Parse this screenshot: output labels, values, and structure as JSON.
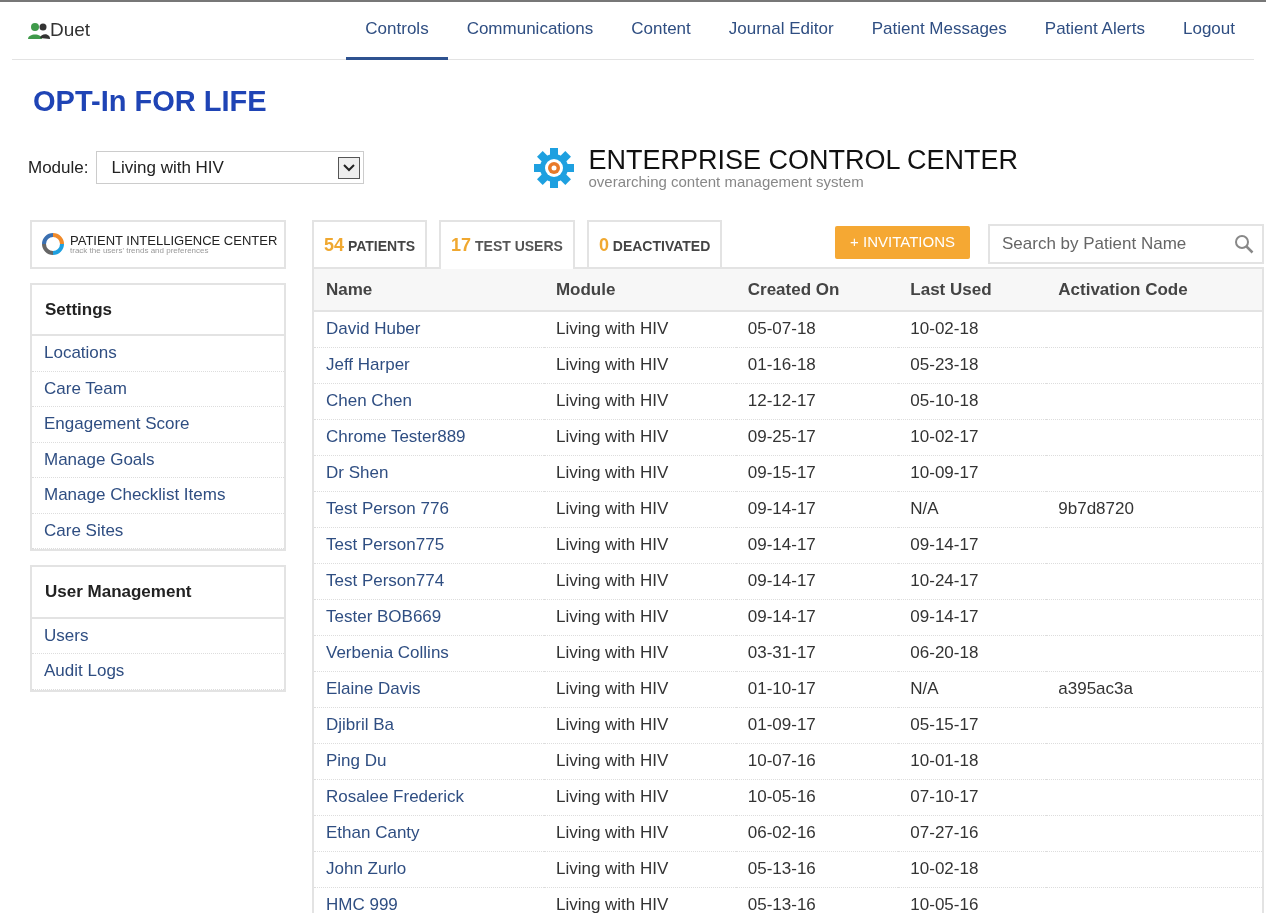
{
  "brand": "Duet",
  "nav": [
    {
      "label": "Controls",
      "selected": true
    },
    {
      "label": "Communications",
      "selected": false
    },
    {
      "label": "Content",
      "selected": false
    },
    {
      "label": "Journal Editor",
      "selected": false
    },
    {
      "label": "Patient Messages",
      "selected": false
    },
    {
      "label": "Patient Alerts",
      "selected": false
    },
    {
      "label": "Logout",
      "selected": false
    }
  ],
  "page_title": "OPT-In FOR LIFE",
  "module_label": "Module:",
  "module_value": "Living with HIV",
  "ecc": {
    "title": "ENTERPRISE CONTROL CENTER",
    "subtitle": "overarching content management system"
  },
  "pic": {
    "title": "PATIENT INTELLIGENCE CENTER",
    "subtitle": "track the users' trends and preferences"
  },
  "sidebar": [
    {
      "heading": "Settings",
      "items": [
        "Locations",
        "Care Team",
        "Engagement Score",
        "Manage Goals",
        "Manage Checklist Items",
        "Care Sites"
      ]
    },
    {
      "heading": "User Management",
      "items": [
        "Users",
        "Audit Logs"
      ]
    }
  ],
  "tabs": [
    {
      "count": "54",
      "label": "PATIENTS",
      "selected": false
    },
    {
      "count": "17",
      "label": "TEST USERS",
      "selected": true
    },
    {
      "count": "0",
      "label": "DEACTIVATED",
      "selected": false
    }
  ],
  "invite_button": "+ INVITATIONS",
  "search": {
    "placeholder": "Search by Patient Name"
  },
  "table": {
    "columns": [
      "Name",
      "Module",
      "Created On",
      "Last Used",
      "Activation Code"
    ],
    "rows": [
      [
        "David Huber",
        "Living with HIV",
        "05-07-18",
        "10-02-18",
        ""
      ],
      [
        "Jeff Harper",
        "Living with HIV",
        "01-16-18",
        "05-23-18",
        ""
      ],
      [
        "Chen Chen",
        "Living with HIV",
        "12-12-17",
        "05-10-18",
        ""
      ],
      [
        "Chrome Tester889",
        "Living with HIV",
        "09-25-17",
        "10-02-17",
        ""
      ],
      [
        "Dr Shen",
        "Living with HIV",
        "09-15-17",
        "10-09-17",
        ""
      ],
      [
        "Test Person 776",
        "Living with HIV",
        "09-14-17",
        "N/A",
        "9b7d8720"
      ],
      [
        "Test Person775",
        "Living with HIV",
        "09-14-17",
        "09-14-17",
        ""
      ],
      [
        "Test Person774",
        "Living with HIV",
        "09-14-17",
        "10-24-17",
        ""
      ],
      [
        "Tester BOB669",
        "Living with HIV",
        "09-14-17",
        "09-14-17",
        ""
      ],
      [
        "Verbenia Collins",
        "Living with HIV",
        "03-31-17",
        "06-20-18",
        ""
      ],
      [
        "Elaine Davis",
        "Living with HIV",
        "01-10-17",
        "N/A",
        "a395ac3a"
      ],
      [
        "Djibril Ba",
        "Living with HIV",
        "01-09-17",
        "05-15-17",
        ""
      ],
      [
        "Ping Du",
        "Living with HIV",
        "10-07-16",
        "10-01-18",
        ""
      ],
      [
        "Rosalee Frederick",
        "Living with HIV",
        "10-05-16",
        "07-10-17",
        ""
      ],
      [
        "Ethan Canty",
        "Living with HIV",
        "06-02-16",
        "07-27-16",
        ""
      ],
      [
        "John Zurlo",
        "Living with HIV",
        "05-13-16",
        "10-02-18",
        ""
      ],
      [
        "HMC 999",
        "Living with HIV",
        "05-13-16",
        "10-05-16",
        ""
      ]
    ]
  }
}
